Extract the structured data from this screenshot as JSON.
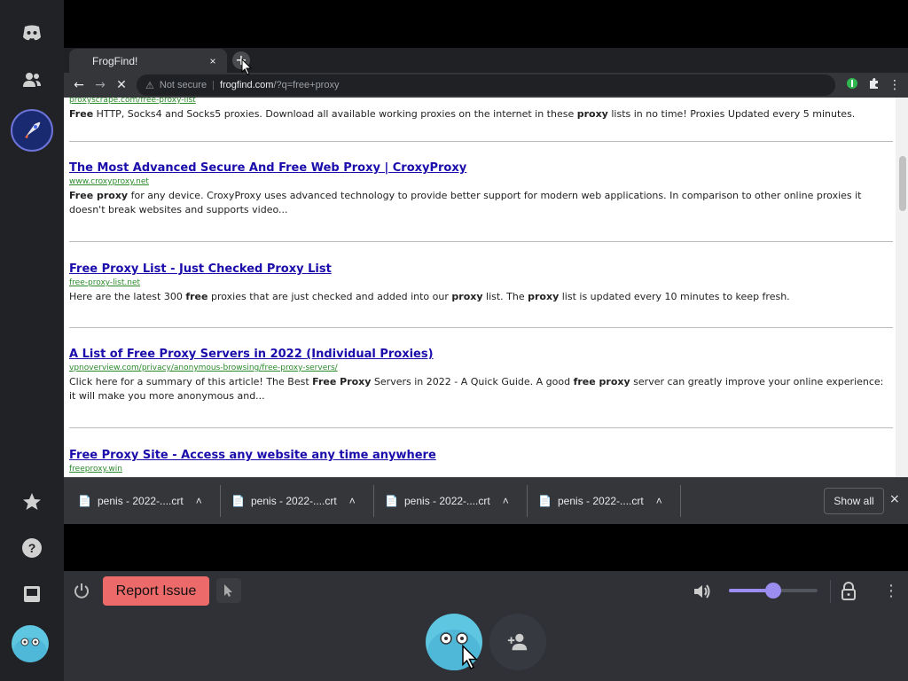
{
  "browser": {
    "tab_title": "FrogFind!",
    "tab_close": "×",
    "new_tab": "+",
    "security_label": "Not secure",
    "url_host": "frogfind.com",
    "url_path": "/?q=free+proxy"
  },
  "results": [
    {
      "title": "",
      "url": "proxyscrape.com/free-proxy-list",
      "snippet_parts": [
        {
          "t": "Free",
          "b": true
        },
        {
          "t": " HTTP, Socks4 and Socks5 proxies. Download all available working proxies on the internet in these ",
          "b": false
        },
        {
          "t": "proxy",
          "b": true
        },
        {
          "t": " lists in no time! Proxies Updated every 5 minutes.",
          "b": false
        }
      ]
    },
    {
      "title": "The Most Advanced Secure And Free Web Proxy | CroxyProxy",
      "url": "www.croxyproxy.net",
      "snippet_parts": [
        {
          "t": "Free proxy",
          "b": true
        },
        {
          "t": " for any device. CroxyProxy uses advanced technology to provide better support for modern web applications. In comparison to other online proxies it doesn't break websites and supports video...",
          "b": false
        }
      ]
    },
    {
      "title": "Free Proxy List - Just Checked Proxy List",
      "url": "free-proxy-list.net",
      "snippet_parts": [
        {
          "t": "Here are the latest 300 ",
          "b": false
        },
        {
          "t": "free",
          "b": true
        },
        {
          "t": " proxies that are just checked and added into our ",
          "b": false
        },
        {
          "t": "proxy",
          "b": true
        },
        {
          "t": " list. The ",
          "b": false
        },
        {
          "t": "proxy",
          "b": true
        },
        {
          "t": " list is updated every 10 minutes to keep fresh.",
          "b": false
        }
      ]
    },
    {
      "title": "A List of Free Proxy Servers in 2022 (Individual Proxies)",
      "url": "vpnoverview.com/privacy/anonymous-browsing/free-proxy-servers/",
      "snippet_parts": [
        {
          "t": "Click here for a summary of this article! The Best ",
          "b": false
        },
        {
          "t": "Free Proxy",
          "b": true
        },
        {
          "t": " Servers in 2022 - A Quick Guide. A good ",
          "b": false
        },
        {
          "t": "free proxy",
          "b": true
        },
        {
          "t": " server can greatly improve your online experience: it will make you more anonymous and...",
          "b": false
        }
      ]
    },
    {
      "title": "Free Proxy Site - Access any website any time anywhere",
      "url": "freeproxy.win",
      "snippet_parts": []
    }
  ],
  "downloads": {
    "items": [
      "penis - 2022-....crt",
      "penis - 2022-....crt",
      "penis - 2022-....crt",
      "penis - 2022-....crt"
    ],
    "show_all": "Show all",
    "close": "×"
  },
  "controls": {
    "report_issue": "Report Issue",
    "volume_level": 0.5
  },
  "colors": {
    "accent": "#9b8cf0",
    "report": "#ed6a6a",
    "link": "#1a0dab",
    "url_green": "#2a8a2a"
  },
  "icons": {
    "rail": [
      "discord-logo-icon",
      "friends-icon",
      "rocket-server-icon",
      "star-icon",
      "help-icon",
      "inbox-icon",
      "user-avatar-icon"
    ],
    "toolbar": [
      "back-arrow-icon",
      "forward-arrow-icon",
      "stop-loading-icon",
      "warning-icon",
      "extension-green-icon",
      "puzzle-icon",
      "kebab-menu-icon"
    ],
    "controls": [
      "power-icon",
      "pointer-icon",
      "volume-icon",
      "lock-icon",
      "kebab-menu-icon",
      "user-add-icon"
    ]
  }
}
